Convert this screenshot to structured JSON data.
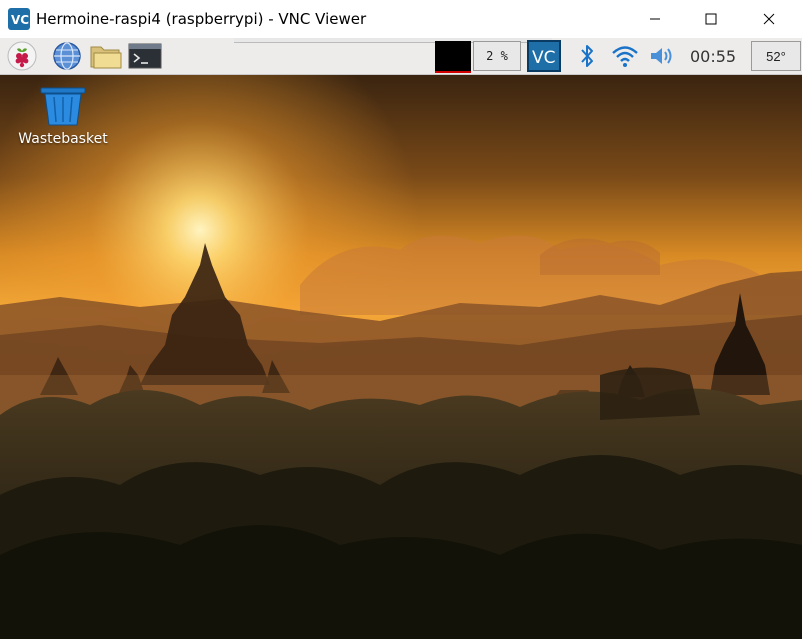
{
  "window": {
    "title": "Hermoine-raspi4 (raspberrypi) - VNC Viewer",
    "app_icon": "vnc-viewer-icon",
    "controls": [
      "minimize-icon",
      "maximize-icon",
      "close-icon"
    ]
  },
  "panel": {
    "launchers": [
      "raspberry-menu-icon",
      "web-browser-icon",
      "file-manager-icon",
      "terminal-icon"
    ],
    "cpu_usage": "2 %",
    "tray": [
      "vnc-server-icon",
      "bluetooth-icon",
      "wifi-icon",
      "volume-icon"
    ],
    "clock": "00:55",
    "temperature": "52°"
  },
  "desktop": {
    "icons": [
      {
        "label": "Wastebasket",
        "icon": "wastebasket-icon"
      }
    ],
    "wallpaper": "sunset-temples-silhouette"
  },
  "colors": {
    "panel_bg": "#edeceb",
    "vnc_blue": "#1e6fa8",
    "sky_top": "#3a2410",
    "sun": "#fff2b0"
  }
}
